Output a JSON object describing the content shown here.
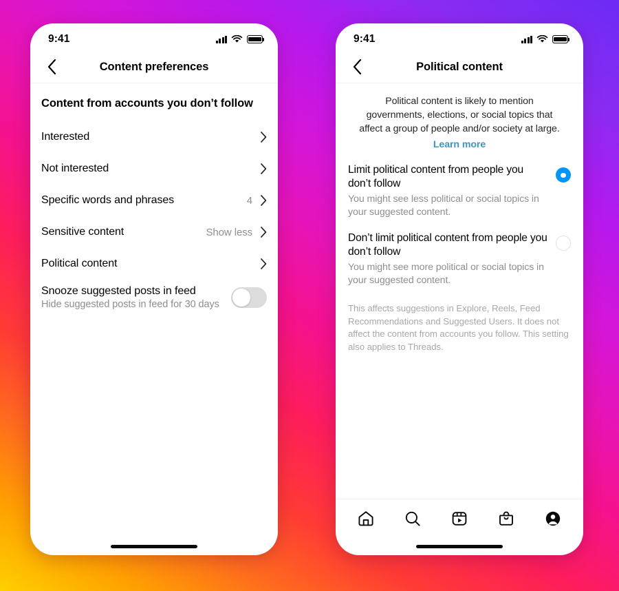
{
  "background": {
    "gradient_colors": [
      "#FFD000",
      "#FF6A1E",
      "#FD1D5B",
      "#E614B8",
      "#B419EE",
      "#6B2BF5"
    ]
  },
  "accent": {
    "radio_selected": "#0095F6",
    "link": "#3897be",
    "secondary_text": "#8e8e8e"
  },
  "status_bar": {
    "time": "9:41",
    "cellular_icon": "cellular-bars-icon",
    "wifi_icon": "wifi-icon",
    "battery_icon": "battery-full-icon"
  },
  "left_phone": {
    "nav": {
      "back_icon": "chevron-left-icon",
      "title": "Content preferences"
    },
    "section_title": "Content from accounts you don’t follow",
    "rows": [
      {
        "label": "Interested",
        "value": "",
        "chevron": true
      },
      {
        "label": "Not interested",
        "value": "",
        "chevron": true
      },
      {
        "label": "Specific words and phrases",
        "value": "4",
        "chevron": true
      },
      {
        "label": "Sensitive content",
        "value": "Show less",
        "chevron": true
      },
      {
        "label": "Political content",
        "value": "",
        "chevron": true
      }
    ],
    "toggle_row": {
      "label": "Snooze suggested posts in feed",
      "sub": "Hide suggested posts in feed for 30 days",
      "state": "off"
    }
  },
  "right_phone": {
    "nav": {
      "back_icon": "chevron-left-icon",
      "title": "Political content"
    },
    "intro": {
      "text": "Political content is likely to mention governments, elections, or social topics that affect a group of people and/or society at large.",
      "link": "Learn more"
    },
    "options": [
      {
        "title": "Limit political content from people you don’t follow",
        "desc": "You might see less political or social topics in your suggested content.",
        "selected": true
      },
      {
        "title": "Don’t limit political content from people you don’t follow",
        "desc": "You might see more political or social topics in your suggested content.",
        "selected": false
      }
    ],
    "footnote": "This affects suggestions in Explore, Reels, Feed Recommendations and Suggested Users. It does not affect the content from accounts you follow. This setting also applies to Threads.",
    "tabs": [
      {
        "name": "home",
        "icon": "home-icon"
      },
      {
        "name": "search",
        "icon": "search-icon"
      },
      {
        "name": "reels",
        "icon": "reels-icon"
      },
      {
        "name": "shop",
        "icon": "shopping-bag-icon"
      },
      {
        "name": "profile",
        "icon": "profile-avatar-icon"
      }
    ]
  }
}
